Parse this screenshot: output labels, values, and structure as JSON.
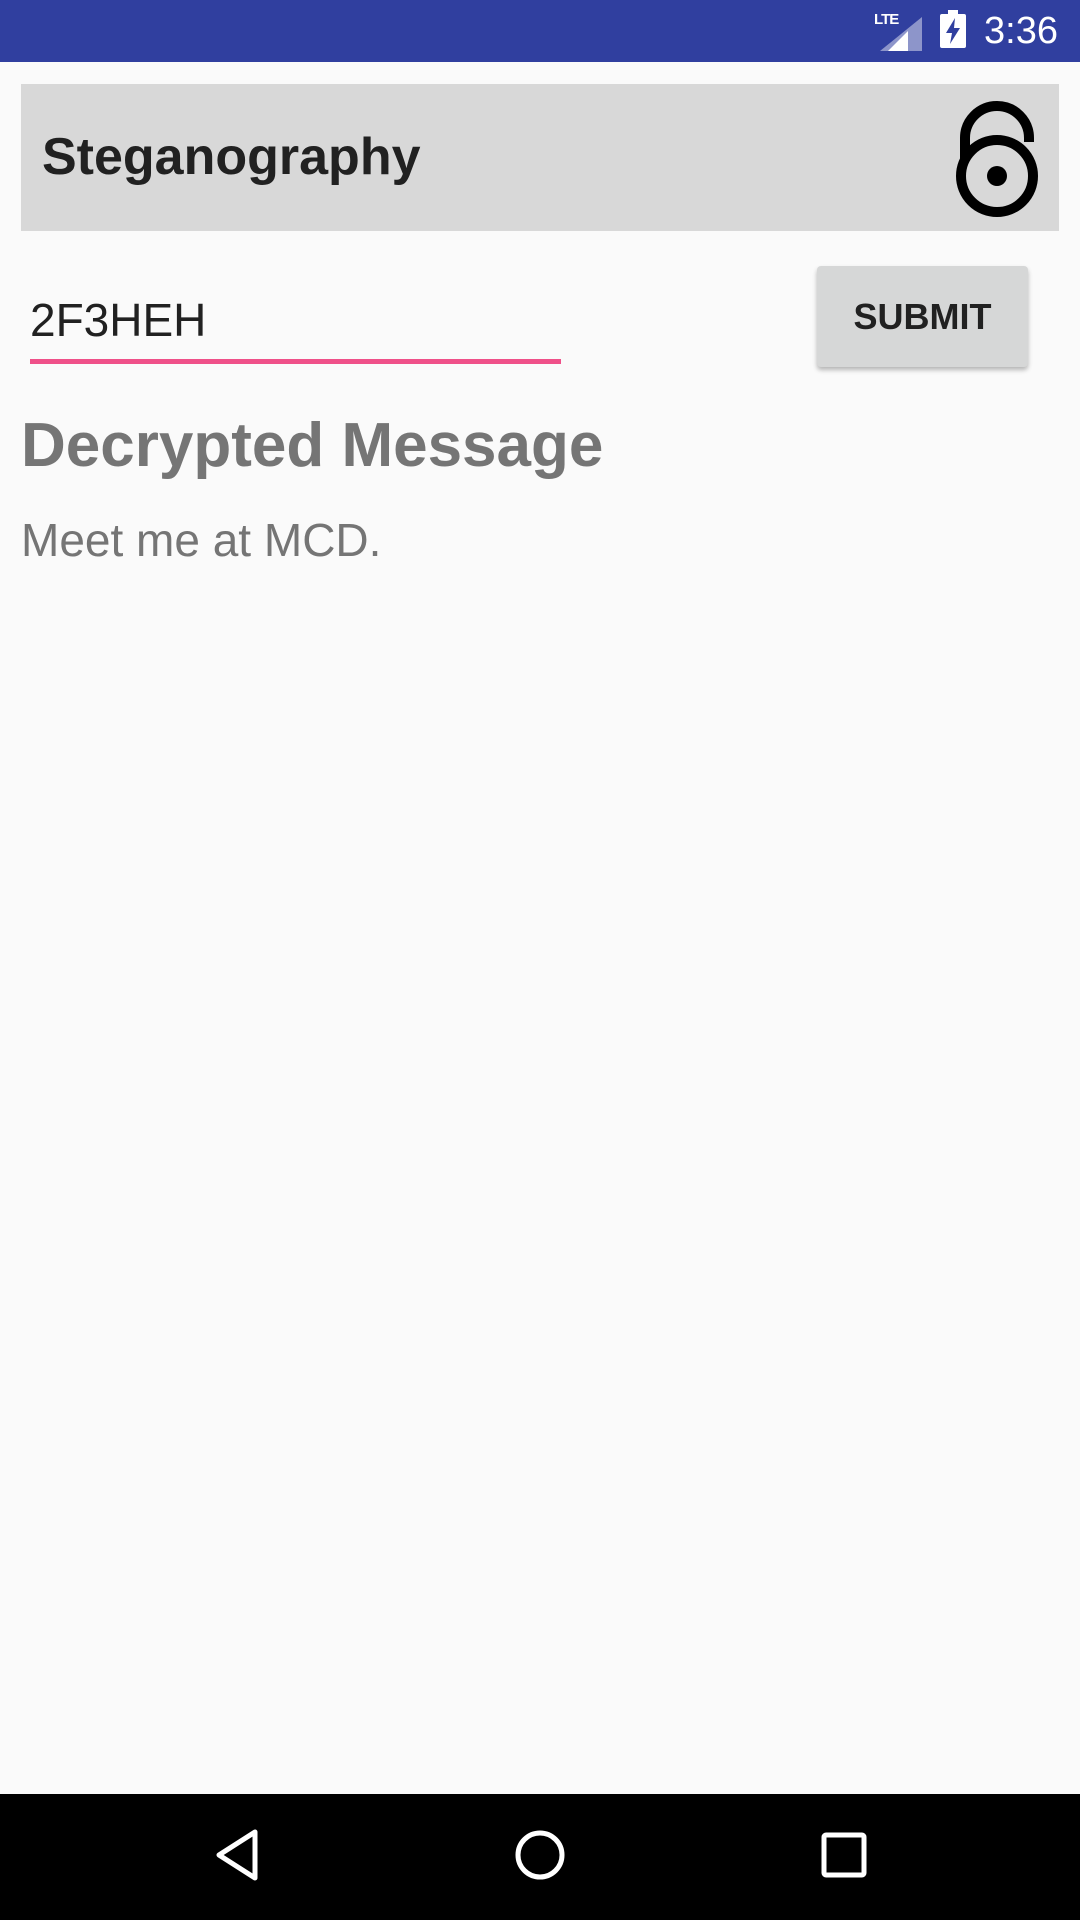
{
  "status_bar": {
    "network": "LTE",
    "time": "3:36",
    "icons": [
      "lte-signal-icon",
      "battery-charging-icon"
    ]
  },
  "header": {
    "title": "Steganography",
    "icon": "unlock-icon"
  },
  "form": {
    "key_value": "2F3HEH",
    "submit_label": "SUBMIT"
  },
  "result": {
    "heading": "Decrypted Message",
    "message": "Meet me at MCD."
  },
  "nav_bar": {
    "icons": [
      "back-icon",
      "home-icon",
      "recents-icon"
    ]
  },
  "colors": {
    "status_bar": "#303f9f",
    "header_bg": "#d8d8d8",
    "accent": "#ef5089",
    "button_bg": "#d6d7d7",
    "muted_text": "#757575",
    "background": "#fafafa"
  }
}
